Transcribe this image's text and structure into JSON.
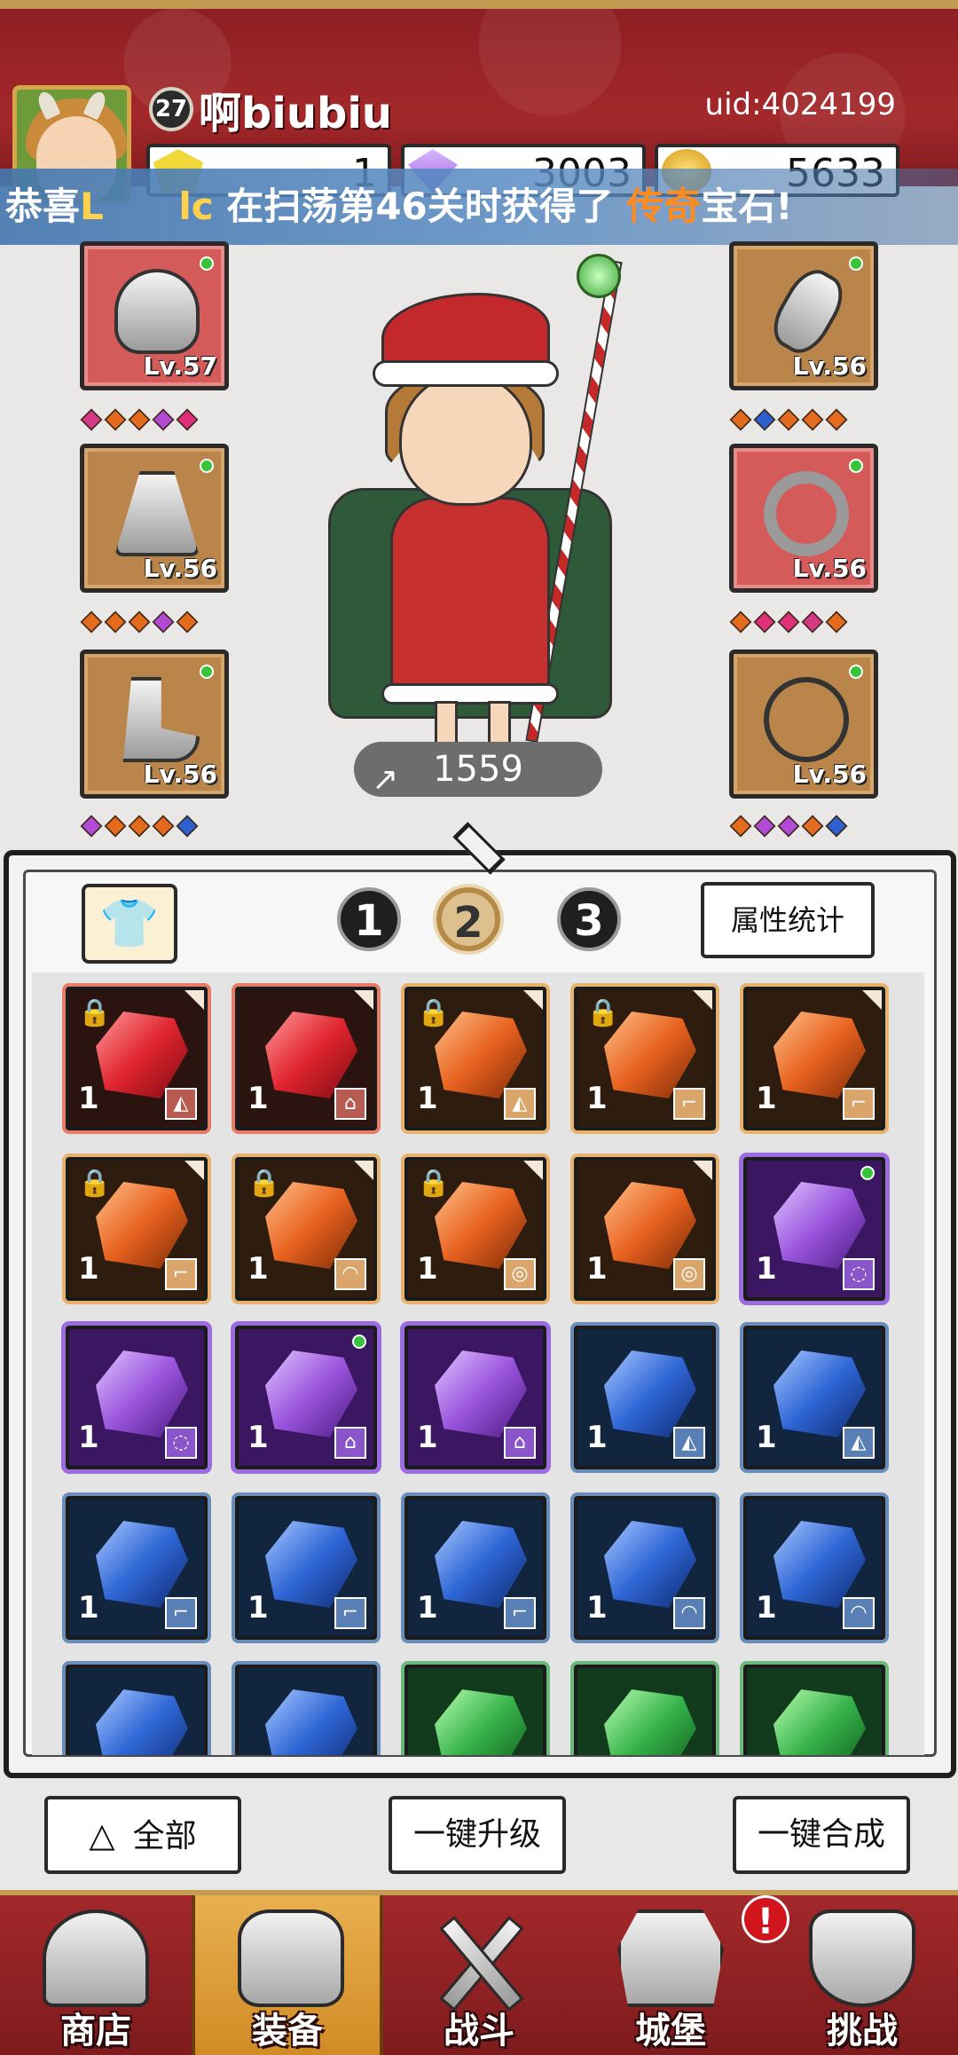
{
  "header": {
    "player_level": "27",
    "player_name": "啊biubiu",
    "uid": "uid:4024199",
    "currencies": [
      {
        "name": "yellow-crystal",
        "value": "1"
      },
      {
        "name": "purple-gem",
        "value": "3003"
      },
      {
        "name": "gold-coin",
        "value": "5633"
      }
    ]
  },
  "broadcast": {
    "prefix": "恭喜",
    "player": "L",
    "player2": "lc",
    "middle": "在扫荡第46关时获得了",
    "rarity": "传奇",
    "item": "宝石!"
  },
  "equipment": {
    "left": [
      {
        "slot": "helmet",
        "level": "Lv.57",
        "rarity": "red"
      },
      {
        "slot": "cape",
        "level": "Lv.56",
        "rarity": "brown"
      },
      {
        "slot": "boots",
        "level": "Lv.56",
        "rarity": "brown"
      }
    ],
    "right": [
      {
        "slot": "arm",
        "level": "Lv.56",
        "rarity": "brown"
      },
      {
        "slot": "ring",
        "level": "Lv.56",
        "rarity": "red"
      },
      {
        "slot": "necklace",
        "level": "Lv.56",
        "rarity": "brown"
      }
    ],
    "power": "1559"
  },
  "tabs": {
    "items": [
      "1",
      "2",
      "3"
    ],
    "active": "2",
    "stats_button": "属性统计"
  },
  "gems": [
    {
      "color": "red",
      "count": "1",
      "locked": true,
      "type": "cape"
    },
    {
      "color": "red",
      "count": "1",
      "locked": false,
      "type": "boots"
    },
    {
      "color": "orange",
      "count": "1",
      "locked": true,
      "type": "cape"
    },
    {
      "color": "orange",
      "count": "1",
      "locked": true,
      "type": "arm"
    },
    {
      "color": "orange",
      "count": "1",
      "locked": false,
      "type": "arm"
    },
    {
      "color": "orange",
      "count": "1",
      "locked": true,
      "type": "arm"
    },
    {
      "color": "orange",
      "count": "1",
      "locked": true,
      "type": "helmet"
    },
    {
      "color": "orange",
      "count": "1",
      "locked": true,
      "type": "ring"
    },
    {
      "color": "orange",
      "count": "1",
      "locked": false,
      "type": "ring"
    },
    {
      "color": "purple",
      "count": "1",
      "locked": false,
      "type": "necklace",
      "new": true
    },
    {
      "color": "purple",
      "count": "1",
      "locked": false,
      "type": "necklace"
    },
    {
      "color": "purple",
      "count": "1",
      "locked": false,
      "type": "boots",
      "new": true
    },
    {
      "color": "purple",
      "count": "1",
      "locked": false,
      "type": "boots"
    },
    {
      "color": "blue",
      "count": "1",
      "locked": false,
      "type": "cape"
    },
    {
      "color": "blue",
      "count": "1",
      "locked": false,
      "type": "cape"
    },
    {
      "color": "blue",
      "count": "1",
      "locked": false,
      "type": "arm"
    },
    {
      "color": "blue",
      "count": "1",
      "locked": false,
      "type": "arm"
    },
    {
      "color": "blue",
      "count": "1",
      "locked": false,
      "type": "arm"
    },
    {
      "color": "blue",
      "count": "1",
      "locked": false,
      "type": "helmet"
    },
    {
      "color": "blue",
      "count": "1",
      "locked": false,
      "type": "helmet"
    },
    {
      "color": "blue",
      "count": "",
      "locked": false,
      "type": ""
    },
    {
      "color": "blue",
      "count": "",
      "locked": false,
      "type": ""
    },
    {
      "color": "green",
      "count": "",
      "locked": false,
      "type": ""
    },
    {
      "color": "green",
      "count": "",
      "locked": false,
      "type": ""
    },
    {
      "color": "green",
      "count": "",
      "locked": false,
      "type": ""
    }
  ],
  "actions": {
    "all_label": "全部",
    "upgrade_label": "一键升级",
    "merge_label": "一键合成"
  },
  "nav": [
    {
      "label": "商店",
      "icon": "shop-icon"
    },
    {
      "label": "装备",
      "icon": "bag-icon"
    },
    {
      "label": "战斗",
      "icon": "swords-icon"
    },
    {
      "label": "城堡",
      "icon": "castle-icon"
    },
    {
      "label": "挑战",
      "icon": "shield-icon"
    }
  ],
  "nav_alert": "!",
  "colors": {
    "header_red": "#a3282a",
    "nav_active": "#e9b050",
    "broadcast_blue": "#5a8cc3"
  }
}
